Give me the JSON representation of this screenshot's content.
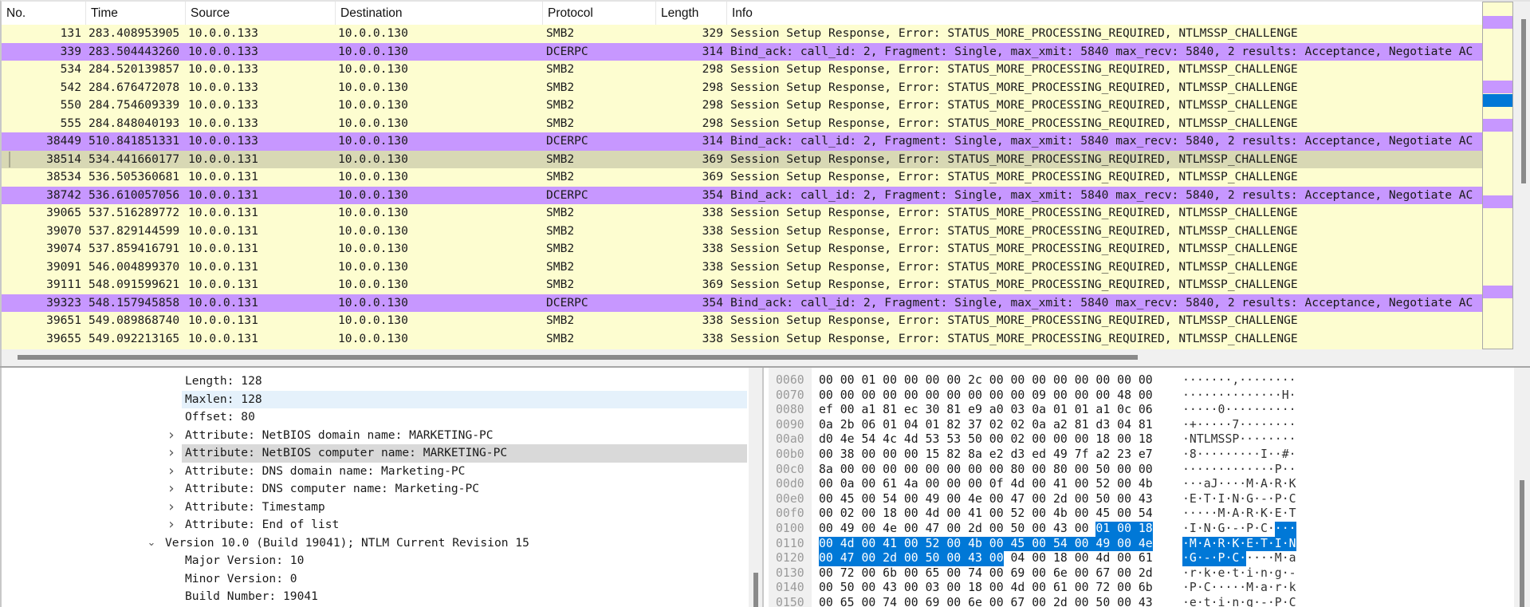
{
  "packet_list": {
    "columns": [
      "No.",
      "Time",
      "Source",
      "Destination",
      "Protocol",
      "Length",
      "Info"
    ],
    "protocol_colors": {
      "SMB2": "#fdfdd0",
      "DCERPC": "#c797ff"
    },
    "selected_color": "#d8d8b4",
    "selected_no": "38514",
    "rows": [
      {
        "no": "131",
        "time": "283.408953905",
        "src": "10.0.0.133",
        "dst": "10.0.0.130",
        "proto": "SMB2",
        "len": "329",
        "info": "Session Setup Response, Error: STATUS_MORE_PROCESSING_REQUIRED, NTLMSSP_CHALLENGE"
      },
      {
        "no": "339",
        "time": "283.504443260",
        "src": "10.0.0.133",
        "dst": "10.0.0.130",
        "proto": "DCERPC",
        "len": "314",
        "info": "Bind_ack: call_id: 2, Fragment: Single, max_xmit: 5840 max_recv: 5840, 2 results: Acceptance, Negotiate AC"
      },
      {
        "no": "534",
        "time": "284.520139857",
        "src": "10.0.0.133",
        "dst": "10.0.0.130",
        "proto": "SMB2",
        "len": "298",
        "info": "Session Setup Response, Error: STATUS_MORE_PROCESSING_REQUIRED, NTLMSSP_CHALLENGE"
      },
      {
        "no": "542",
        "time": "284.676472078",
        "src": "10.0.0.133",
        "dst": "10.0.0.130",
        "proto": "SMB2",
        "len": "298",
        "info": "Session Setup Response, Error: STATUS_MORE_PROCESSING_REQUIRED, NTLMSSP_CHALLENGE"
      },
      {
        "no": "550",
        "time": "284.754609339",
        "src": "10.0.0.133",
        "dst": "10.0.0.130",
        "proto": "SMB2",
        "len": "298",
        "info": "Session Setup Response, Error: STATUS_MORE_PROCESSING_REQUIRED, NTLMSSP_CHALLENGE"
      },
      {
        "no": "555",
        "time": "284.848040193",
        "src": "10.0.0.133",
        "dst": "10.0.0.130",
        "proto": "SMB2",
        "len": "298",
        "info": "Session Setup Response, Error: STATUS_MORE_PROCESSING_REQUIRED, NTLMSSP_CHALLENGE"
      },
      {
        "no": "38449",
        "time": "510.841851331",
        "src": "10.0.0.133",
        "dst": "10.0.0.130",
        "proto": "DCERPC",
        "len": "314",
        "info": "Bind_ack: call_id: 2, Fragment: Single, max_xmit: 5840 max_recv: 5840, 2 results: Acceptance, Negotiate AC"
      },
      {
        "no": "38514",
        "time": "534.441660177",
        "src": "10.0.0.131",
        "dst": "10.0.0.130",
        "proto": "SMB2",
        "len": "369",
        "info": "Session Setup Response, Error: STATUS_MORE_PROCESSING_REQUIRED, NTLMSSP_CHALLENGE"
      },
      {
        "no": "38534",
        "time": "536.505360681",
        "src": "10.0.0.131",
        "dst": "10.0.0.130",
        "proto": "SMB2",
        "len": "369",
        "info": "Session Setup Response, Error: STATUS_MORE_PROCESSING_REQUIRED, NTLMSSP_CHALLENGE"
      },
      {
        "no": "38742",
        "time": "536.610057056",
        "src": "10.0.0.131",
        "dst": "10.0.0.130",
        "proto": "DCERPC",
        "len": "354",
        "info": "Bind_ack: call_id: 2, Fragment: Single, max_xmit: 5840 max_recv: 5840, 2 results: Acceptance, Negotiate AC"
      },
      {
        "no": "39065",
        "time": "537.516289772",
        "src": "10.0.0.131",
        "dst": "10.0.0.130",
        "proto": "SMB2",
        "len": "338",
        "info": "Session Setup Response, Error: STATUS_MORE_PROCESSING_REQUIRED, NTLMSSP_CHALLENGE"
      },
      {
        "no": "39070",
        "time": "537.829144599",
        "src": "10.0.0.131",
        "dst": "10.0.0.130",
        "proto": "SMB2",
        "len": "338",
        "info": "Session Setup Response, Error: STATUS_MORE_PROCESSING_REQUIRED, NTLMSSP_CHALLENGE"
      },
      {
        "no": "39074",
        "time": "537.859416791",
        "src": "10.0.0.131",
        "dst": "10.0.0.130",
        "proto": "SMB2",
        "len": "338",
        "info": "Session Setup Response, Error: STATUS_MORE_PROCESSING_REQUIRED, NTLMSSP_CHALLENGE"
      },
      {
        "no": "39091",
        "time": "546.004899370",
        "src": "10.0.0.131",
        "dst": "10.0.0.130",
        "proto": "SMB2",
        "len": "338",
        "info": "Session Setup Response, Error: STATUS_MORE_PROCESSING_REQUIRED, NTLMSSP_CHALLENGE"
      },
      {
        "no": "39111",
        "time": "548.091599621",
        "src": "10.0.0.131",
        "dst": "10.0.0.130",
        "proto": "SMB2",
        "len": "369",
        "info": "Session Setup Response, Error: STATUS_MORE_PROCESSING_REQUIRED, NTLMSSP_CHALLENGE"
      },
      {
        "no": "39323",
        "time": "548.157945858",
        "src": "10.0.0.131",
        "dst": "10.0.0.130",
        "proto": "DCERPC",
        "len": "354",
        "info": "Bind_ack: call_id: 2, Fragment: Single, max_xmit: 5840 max_recv: 5840, 2 results: Acceptance, Negotiate AC"
      },
      {
        "no": "39651",
        "time": "549.089868740",
        "src": "10.0.0.131",
        "dst": "10.0.0.130",
        "proto": "SMB2",
        "len": "338",
        "info": "Session Setup Response, Error: STATUS_MORE_PROCESSING_REQUIRED, NTLMSSP_CHALLENGE"
      },
      {
        "no": "39655",
        "time": "549.092213165",
        "src": "10.0.0.131",
        "dst": "10.0.0.130",
        "proto": "SMB2",
        "len": "338",
        "info": "Session Setup Response, Error: STATUS_MORE_PROCESSING_REQUIRED, NTLMSSP_CHALLENGE"
      }
    ]
  },
  "minimap": {
    "background": "#fdfdd0",
    "bands": [
      {
        "kind": "dcerpc",
        "color": "#c797ff",
        "pos": 0.04
      },
      {
        "kind": "dcerpc",
        "color": "#c797ff",
        "pos": 0.225
      },
      {
        "kind": "current",
        "color": "#0078d7",
        "pos": 0.265
      },
      {
        "kind": "dcerpc",
        "color": "#c797ff",
        "pos": 0.336
      },
      {
        "kind": "dcerpc",
        "color": "#c797ff",
        "pos": 0.558
      },
      {
        "kind": "dcerpc",
        "color": "#c797ff",
        "pos": 0.817
      }
    ]
  },
  "details": {
    "rows": [
      {
        "level": 3,
        "expander": "none",
        "text": "Length: 128",
        "highlight": ""
      },
      {
        "level": 3,
        "expander": "none",
        "text": "Maxlen: 128",
        "highlight": "blue"
      },
      {
        "level": 3,
        "expander": "none",
        "text": "Offset: 80",
        "highlight": ""
      },
      {
        "level": 3,
        "expander": "collapsed",
        "text": "Attribute: NetBIOS domain name: MARKETING-PC",
        "highlight": ""
      },
      {
        "level": 3,
        "expander": "collapsed",
        "text": "Attribute: NetBIOS computer name: MARKETING-PC",
        "highlight": "gray"
      },
      {
        "level": 3,
        "expander": "collapsed",
        "text": "Attribute: DNS domain name: Marketing-PC",
        "highlight": ""
      },
      {
        "level": 3,
        "expander": "collapsed",
        "text": "Attribute: DNS computer name: Marketing-PC",
        "highlight": ""
      },
      {
        "level": 3,
        "expander": "collapsed",
        "text": "Attribute: Timestamp",
        "highlight": ""
      },
      {
        "level": 3,
        "expander": "collapsed",
        "text": "Attribute: End of list",
        "highlight": ""
      },
      {
        "level": 2,
        "expander": "expanded",
        "text": "Version 10.0 (Build 19041); NTLM Current Revision 15",
        "highlight": ""
      },
      {
        "level": 3,
        "expander": "none",
        "text": "Major Version: 10",
        "highlight": ""
      },
      {
        "level": 3,
        "expander": "none",
        "text": "Minor Version: 0",
        "highlight": ""
      },
      {
        "level": 3,
        "expander": "none",
        "text": "Build Number: 19041",
        "highlight": ""
      }
    ]
  },
  "hex": {
    "selection_color": "#0078d7",
    "selection": {
      "start": 269,
      "end": 296
    },
    "rows": [
      {
        "offset": "0060",
        "bytes": "00 00 01 00 00 00 00 2c 00 00 00 00 00 00 00 00",
        "ascii": "·······,········"
      },
      {
        "offset": "0070",
        "bytes": "00 00 00 00 00 00 00 00 00 00 09 00 00 00 48 00",
        "ascii": "··············H·"
      },
      {
        "offset": "0080",
        "bytes": "ef 00 a1 81 ec 30 81 e9 a0 03 0a 01 01 a1 0c 06",
        "ascii": "·····0··········"
      },
      {
        "offset": "0090",
        "bytes": "0a 2b 06 01 04 01 82 37 02 02 0a a2 81 d3 04 81",
        "ascii": "·+·····7········"
      },
      {
        "offset": "00a0",
        "bytes": "d0 4e 54 4c 4d 53 53 50 00 02 00 00 00 18 00 18",
        "ascii": "·NTLMSSP········"
      },
      {
        "offset": "00b0",
        "bytes": "00 38 00 00 00 15 82 8a e2 d3 ed 49 7f a2 23 e7",
        "ascii": "·8·········I··#·"
      },
      {
        "offset": "00c0",
        "bytes": "8a 00 00 00 00 00 00 00 00 80 00 80 00 50 00 00",
        "ascii": "·············P··"
      },
      {
        "offset": "00d0",
        "bytes": "00 0a 00 61 4a 00 00 00 0f 4d 00 41 00 52 00 4b",
        "ascii": "···aJ····M·A·R·K"
      },
      {
        "offset": "00e0",
        "bytes": "00 45 00 54 00 49 00 4e 00 47 00 2d 00 50 00 43",
        "ascii": "·E·T·I·N·G·-·P·C"
      },
      {
        "offset": "00f0",
        "bytes": "00 02 00 18 00 4d 00 41 00 52 00 4b 00 45 00 54",
        "ascii": "·····M·A·R·K·E·T"
      },
      {
        "offset": "0100",
        "bytes": "00 49 00 4e 00 47 00 2d 00 50 00 43 00 01 00 18",
        "ascii": "·I·N·G·-·P·C····"
      },
      {
        "offset": "0110",
        "bytes": "00 4d 00 41 00 52 00 4b 00 45 00 54 00 49 00 4e",
        "ascii": "·M·A·R·K·E·T·I·N"
      },
      {
        "offset": "0120",
        "bytes": "00 47 00 2d 00 50 00 43 00 04 00 18 00 4d 00 61",
        "ascii": "·G·-·P·C·····M·a"
      },
      {
        "offset": "0130",
        "bytes": "00 72 00 6b 00 65 00 74 00 69 00 6e 00 67 00 2d",
        "ascii": "·r·k·e·t·i·n·g·-"
      },
      {
        "offset": "0140",
        "bytes": "00 50 00 43 00 03 00 18 00 4d 00 61 00 72 00 6b",
        "ascii": "·P·C·····M·a·r·k"
      },
      {
        "offset": "0150",
        "bytes": "00 65 00 74 00 69 00 6e 00 67 00 2d 00 50 00 43",
        "ascii": "·e·t·i·n·g·-·P·C"
      }
    ]
  }
}
